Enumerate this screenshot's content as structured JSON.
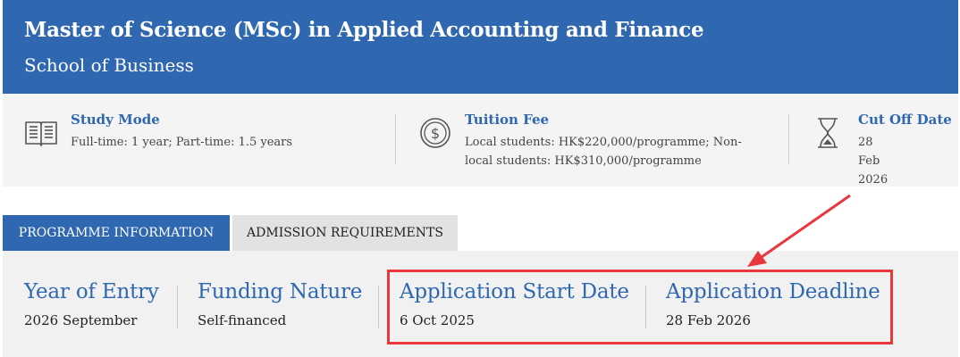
{
  "header": {
    "title": "Master of Science (MSc) in Applied Accounting and Finance",
    "subtitle": "School of Business"
  },
  "info": [
    {
      "icon": "book-icon",
      "label": "Study Mode",
      "value": "Full-time: 1 year; Part-time: 1.5 years"
    },
    {
      "icon": "dollar-coin-icon",
      "label": "Tuition Fee",
      "value": "Local students: HK$220,000/programme; Non-local students: HK$310,000/programme"
    },
    {
      "icon": "hourglass-icon",
      "label": "Cut Off Date",
      "value": "28 Feb 2026"
    }
  ],
  "tabs": [
    {
      "label": "PROGRAMME INFORMATION",
      "active": true
    },
    {
      "label": "ADMISSION REQUIREMENTS",
      "active": false
    }
  ],
  "details": [
    {
      "heading": "Year of Entry",
      "value": "2026 September"
    },
    {
      "heading": "Funding Nature",
      "value": "Self-financed"
    },
    {
      "heading": "Application Start Date",
      "value": "6 Oct 2025"
    },
    {
      "heading": "Application Deadline",
      "value": "28 Feb 2026"
    }
  ],
  "colors": {
    "brand_blue": "#2f67b0",
    "annotation_red": "#e8383d",
    "panel_gray": "#f1f1f1"
  }
}
